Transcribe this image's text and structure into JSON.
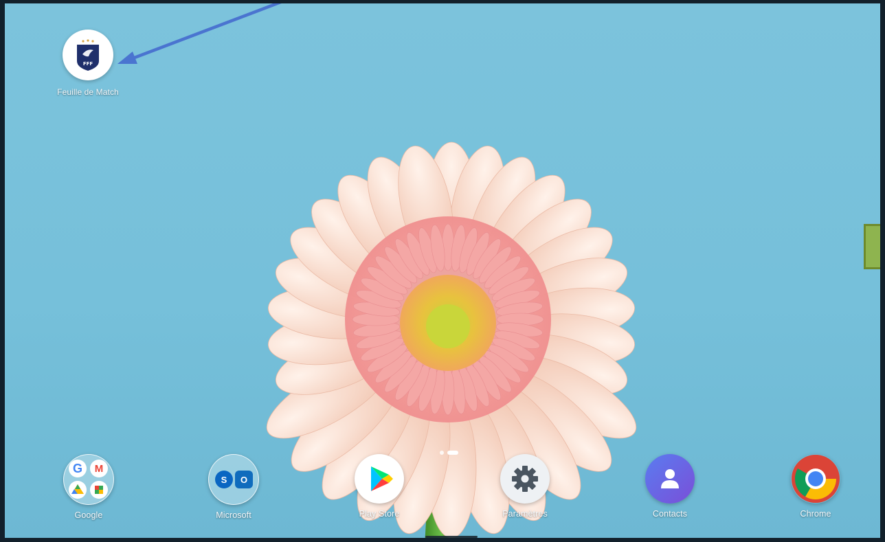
{
  "home_screen": {
    "apps": [
      {
        "id": "fdm",
        "label": "Feuille de Match",
        "icon": "fff-logo-icon",
        "logo_text": "FFF"
      }
    ]
  },
  "dock": {
    "apps": [
      {
        "id": "google",
        "label": "Google",
        "icon": "google-folder-icon",
        "type": "folder"
      },
      {
        "id": "microsoft",
        "label": "Microsoft",
        "icon": "microsoft-folder-icon",
        "type": "folder"
      },
      {
        "id": "playstore",
        "label": "Play Store",
        "icon": "play-store-icon"
      },
      {
        "id": "settings",
        "label": "Paramètres",
        "icon": "gear-icon"
      },
      {
        "id": "contacts",
        "label": "Contacts",
        "icon": "contacts-icon"
      },
      {
        "id": "chrome",
        "label": "Chrome",
        "icon": "chrome-icon"
      }
    ]
  },
  "page_indicator": {
    "pages": 2,
    "current": 2
  },
  "annotations": {
    "arrow_color": "#4a74d0",
    "highlight_box_color": "#8eb44f"
  },
  "colors": {
    "wallpaper_sky": "#7cc3dc",
    "flower_petal": "#f7d8c8",
    "flower_center": "#d7d83c",
    "stem": "#4f9a2a"
  }
}
